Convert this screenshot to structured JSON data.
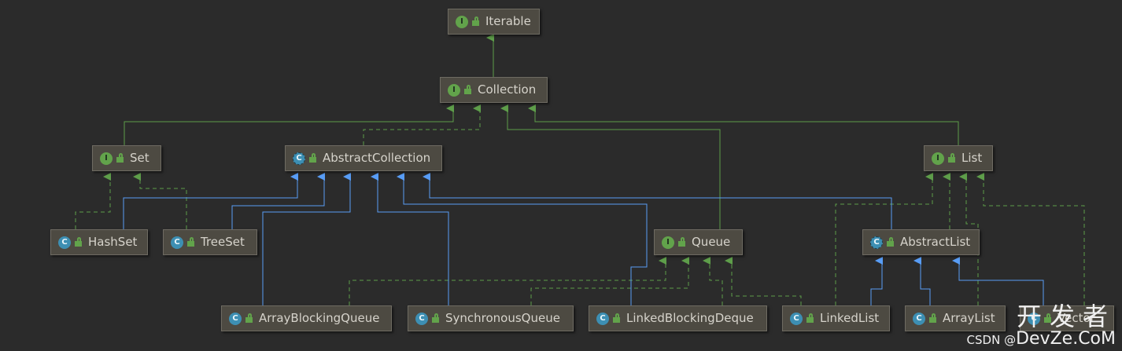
{
  "nodes": {
    "iterable": {
      "label": "Iterable",
      "kind": "I"
    },
    "collection": {
      "label": "Collection",
      "kind": "I"
    },
    "set": {
      "label": "Set",
      "kind": "I"
    },
    "abstract_collection": {
      "label": "AbstractCollection",
      "kind": "C"
    },
    "list": {
      "label": "List",
      "kind": "I"
    },
    "hashset": {
      "label": "HashSet",
      "kind": "C"
    },
    "treeset": {
      "label": "TreeSet",
      "kind": "C"
    },
    "queue": {
      "label": "Queue",
      "kind": "I"
    },
    "abstract_list": {
      "label": "AbstractList",
      "kind": "C"
    },
    "array_blocking_queue": {
      "label": "ArrayBlockingQueue",
      "kind": "C"
    },
    "synchronous_queue": {
      "label": "SynchronousQueue",
      "kind": "C"
    },
    "linked_blocking_deque": {
      "label": "LinkedBlockingDeque",
      "kind": "C"
    },
    "linked_list": {
      "label": "LinkedList",
      "kind": "C"
    },
    "array_list": {
      "label": "ArrayList",
      "kind": "C"
    },
    "vector": {
      "label": "Vector",
      "kind": "C"
    }
  },
  "legend": {
    "interface_badge": "I",
    "class_badge": "C",
    "lock_icon": "unlock-icon"
  },
  "colors": {
    "background": "#2b2b2b",
    "node_fill": "#4d4a42",
    "extends_edge": "#5e9e4a",
    "implements_edge": "#589df6",
    "interface_badge": "#62a34b",
    "class_badge": "#3d8fb3"
  },
  "watermark": {
    "cn": "开发者",
    "csdn": "CSDN @",
    "site": "DevZe.CoM"
  }
}
